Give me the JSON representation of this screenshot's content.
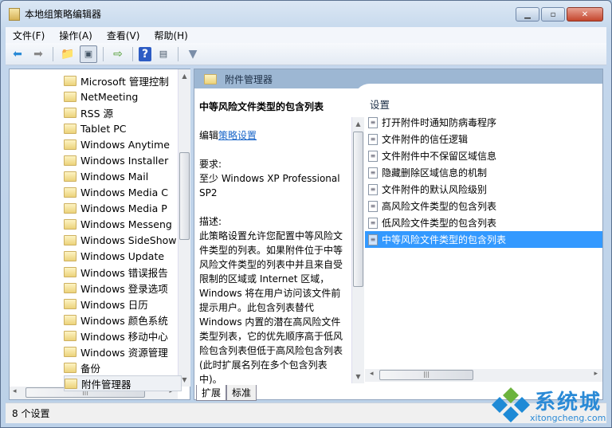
{
  "window": {
    "title": "本地组策略编辑器",
    "controls": [
      "minimize",
      "maximize",
      "close"
    ]
  },
  "menu": [
    "文件(F)",
    "操作(A)",
    "查看(V)",
    "帮助(H)"
  ],
  "toolbar": [
    "back-icon",
    "forward-icon",
    "up-folder-icon",
    "show-hide-tree-icon",
    "export-list-icon",
    "help-icon",
    "show-action-pane-icon",
    "filter-icon"
  ],
  "tree": [
    {
      "label": "Microsoft 管理控制",
      "expandable": true
    },
    {
      "label": "NetMeeting",
      "expandable": true
    },
    {
      "label": "RSS 源",
      "expandable": false
    },
    {
      "label": "Tablet PC",
      "expandable": true
    },
    {
      "label": "Windows Anytime",
      "expandable": false
    },
    {
      "label": "Windows Installer",
      "expandable": false
    },
    {
      "label": "Windows Mail",
      "expandable": false
    },
    {
      "label": "Windows Media C",
      "expandable": false
    },
    {
      "label": "Windows Media P",
      "expandable": true
    },
    {
      "label": "Windows Messeng",
      "expandable": false
    },
    {
      "label": "Windows SideShow",
      "expandable": false
    },
    {
      "label": "Windows Update",
      "expandable": false
    },
    {
      "label": "Windows 错误报告",
      "expandable": true
    },
    {
      "label": "Windows 登录选项",
      "expandable": false
    },
    {
      "label": "Windows 日历",
      "expandable": false
    },
    {
      "label": "Windows 颜色系统",
      "expandable": false
    },
    {
      "label": "Windows 移动中心",
      "expandable": false
    },
    {
      "label": "Windows 资源管理",
      "expandable": true
    },
    {
      "label": "备份",
      "expandable": true
    },
    {
      "label": "附件管理器",
      "expandable": false,
      "selected": true
    }
  ],
  "header": {
    "title": "附件管理器"
  },
  "description": {
    "title": "中等风险文件类型的包含列表",
    "edit_prefix": "编辑",
    "edit_link": "策略设置",
    "req_label": "要求:",
    "req_lines": [
      "至少 Windows XP Professional",
      "SP2"
    ],
    "desc_label": "描述:",
    "desc_lines": [
      "此策略设置允许您配置中等风险文",
      "件类型的列表。如果附件位于中等",
      "风险文件类型的列表中并且来自受",
      "限制的区域或 Internet 区域，",
      "Windows 将在用户访问该文件前",
      "提示用户。此包含列表替代",
      "Windows 内置的潜在高风险文件",
      "类型列表，它的优先顺序高于低风",
      "险包含列表但低于高风险包含列表",
      "(此时扩展名列在多个包含列表",
      "中)。"
    ]
  },
  "settings": {
    "column": "设置",
    "items": [
      "打开附件时通知防病毒程序",
      "文件附件的信任逻辑",
      "文件附件中不保留区域信息",
      "隐藏删除区域信息的机制",
      "文件附件的默认风险级别",
      "高风险文件类型的包含列表",
      "低风险文件类型的包含列表",
      "中等风险文件类型的包含列表"
    ],
    "selected_index": 7
  },
  "tabs": [
    "扩展",
    "标准"
  ],
  "status": "8 个设置",
  "watermark": {
    "text": "系统城",
    "url": "xitongcheng.com"
  },
  "colors": {
    "selection": "#3399ff",
    "header": "#9db7d3",
    "link": "#1a66c9"
  }
}
